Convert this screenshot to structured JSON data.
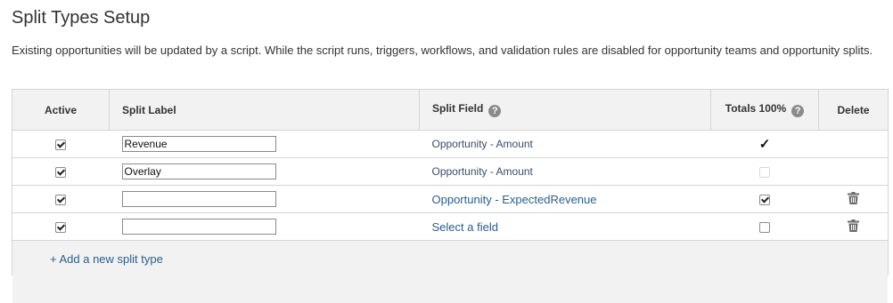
{
  "page": {
    "title": "Split Types Setup",
    "notice": "Existing opportunities will be updated by a script. While the script runs, triggers, workflows, and validation rules are disabled for opportunity teams and opportunity splits."
  },
  "table": {
    "headers": {
      "active": "Active",
      "split_label": "Split Label",
      "split_field": "Split Field",
      "totals": "Totals 100%",
      "delete": "Delete"
    },
    "rows": [
      {
        "active": true,
        "label": "Revenue",
        "field": "Opportunity - Amount",
        "field_style": "static",
        "totals": "bold-check",
        "deletable": false
      },
      {
        "active": true,
        "label": "Overlay",
        "field": "Opportunity - Amount",
        "field_style": "static",
        "totals": "faint-unchecked",
        "deletable": false
      },
      {
        "active": true,
        "label": "",
        "field": "Opportunity - ExpectedRevenue",
        "field_style": "link",
        "totals": "checked",
        "deletable": true
      },
      {
        "active": true,
        "label": "",
        "field": "Select a field",
        "field_style": "link",
        "totals": "unchecked",
        "deletable": true
      }
    ],
    "add_link": "+ Add a new split type"
  },
  "icons": {
    "help": "help-circle-icon",
    "delete": "trash-icon"
  },
  "colors": {
    "link": "#2a5d8c",
    "header_bg": "#f2f2f2",
    "border": "#d4d4d4"
  }
}
